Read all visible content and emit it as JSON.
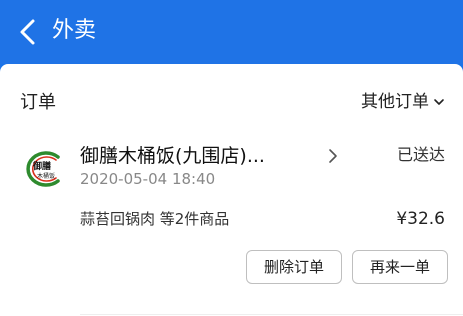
{
  "header": {
    "title": "外卖"
  },
  "orders_section": {
    "title": "订单",
    "other_orders_label": "其他订单"
  },
  "order": {
    "store_name": "御膳木桶饭(九围店)...",
    "status": "已送达",
    "time": "2020-05-04 18:40",
    "items_summary": "蒜苔回锅肉 等2件商品",
    "price": "¥32.6",
    "logo_text": "御膳木桶饭",
    "actions": {
      "delete_label": "删除订单",
      "reorder_label": "再来一单"
    }
  },
  "colors": {
    "header_bg": "#1f73e6",
    "logo_green": "#2e8b2e",
    "logo_red": "#d8301c"
  },
  "icons": {
    "back": "chevron-left-icon",
    "expand": "chevron-down-icon",
    "detail": "chevron-right-icon"
  }
}
